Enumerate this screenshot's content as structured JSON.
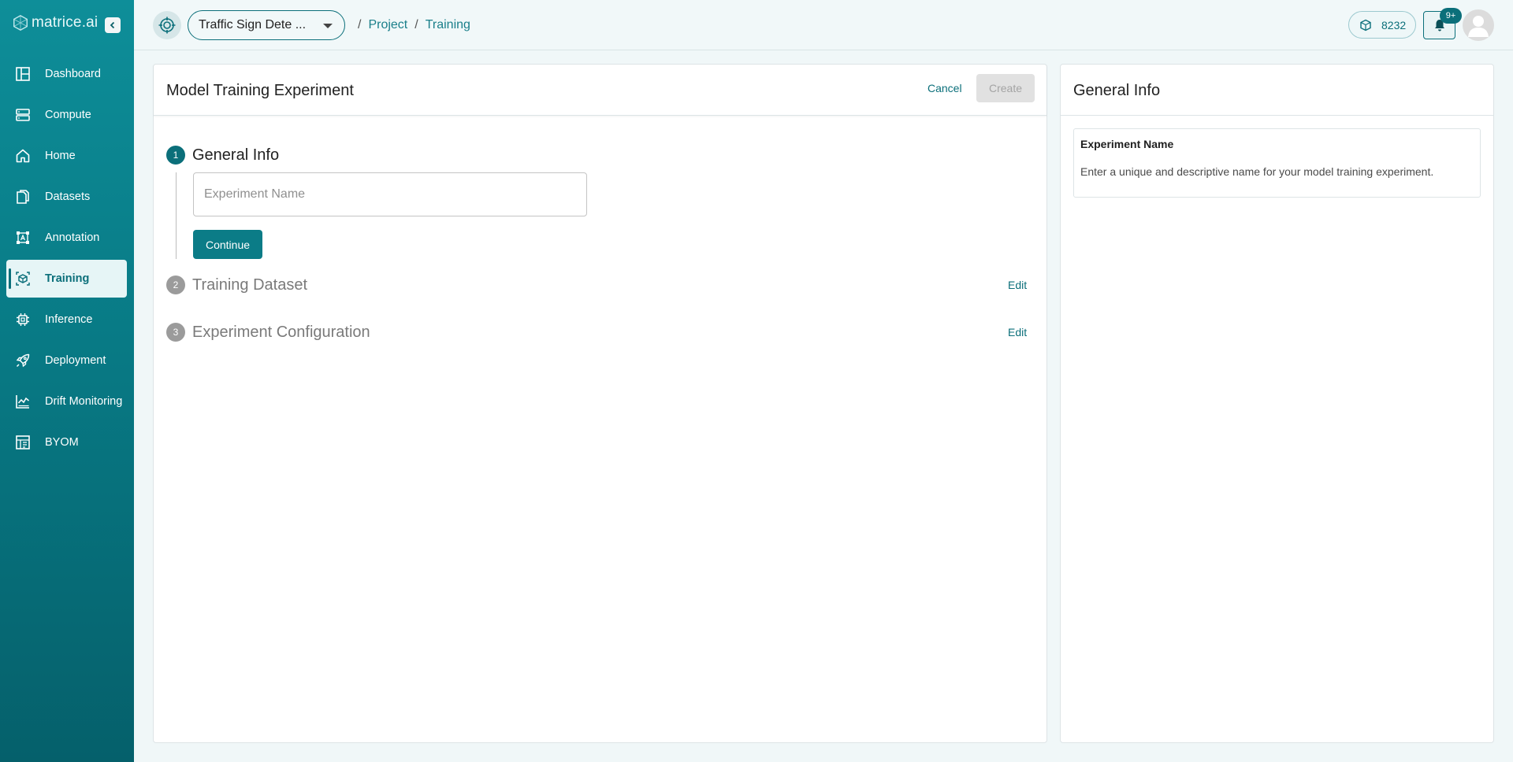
{
  "brand": {
    "name": "matrice.ai",
    "collapse_icon": "chevron-left-icon"
  },
  "sidebar": {
    "items": [
      {
        "label": "Dashboard",
        "icon": "dashboard-icon",
        "active": false
      },
      {
        "label": "Compute",
        "icon": "server-icon",
        "active": false
      },
      {
        "label": "Home",
        "icon": "home-icon",
        "active": false
      },
      {
        "label": "Datasets",
        "icon": "files-icon",
        "active": false
      },
      {
        "label": "Annotation",
        "icon": "annotation-icon",
        "active": false
      },
      {
        "label": "Training",
        "icon": "cube-icon",
        "active": true
      },
      {
        "label": "Inference",
        "icon": "chip-icon",
        "active": false
      },
      {
        "label": "Deployment",
        "icon": "rocket-icon",
        "active": false
      },
      {
        "label": "Drift Monitoring",
        "icon": "chart-icon",
        "active": false
      },
      {
        "label": "BYOM",
        "icon": "model-icon",
        "active": false
      }
    ]
  },
  "topbar": {
    "project_name": "Traffic Sign Dete ...",
    "breadcrumb": [
      "Project",
      "Training"
    ],
    "credits": "8232",
    "notification_badge": "9+"
  },
  "main": {
    "title": "Model Training Experiment",
    "cancel_label": "Cancel",
    "create_label": "Create",
    "steps": [
      {
        "number": "1",
        "label": "General Info"
      },
      {
        "number": "2",
        "label": "Training Dataset",
        "edit_label": "Edit"
      },
      {
        "number": "3",
        "label": "Experiment Configuration",
        "edit_label": "Edit"
      }
    ],
    "experiment_name": {
      "value": "",
      "placeholder": "Experiment Name"
    },
    "continue_label": "Continue"
  },
  "info": {
    "title": "General Info",
    "field_title": "Experiment Name",
    "field_description": "Enter a unique and descriptive name for your model training experiment."
  },
  "colors": {
    "accent": "#0b6f7a",
    "sidebar_top": "#0e8e99",
    "sidebar_bottom": "#05606b",
    "disabled": "#e1e1e1"
  }
}
